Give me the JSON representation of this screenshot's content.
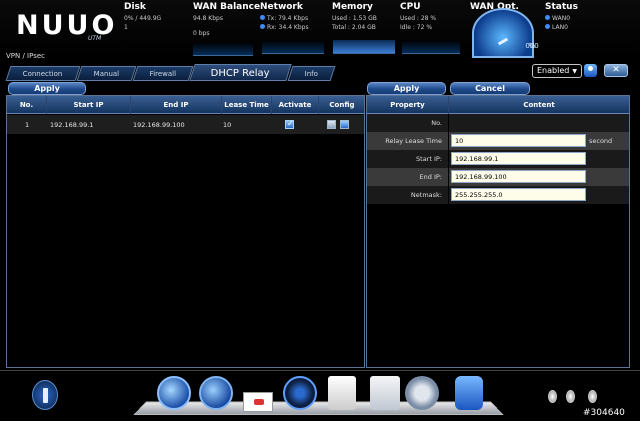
{
  "brand": {
    "logo": "NUUO",
    "logo_sub": "UTM"
  },
  "status": {
    "disk": {
      "title": "Disk",
      "value": "0% / 449.9G",
      "fill": 0.01,
      "line2": "1"
    },
    "wan_balance": {
      "title": "WAN Balance",
      "value": "94.8 Kbps",
      "value2": "0 bps"
    },
    "network": {
      "title": "Network",
      "tx": "Tx: 79.4 Kbps",
      "rx": "Rx: 34.4 Kbps"
    },
    "memory": {
      "title": "Memory",
      "used": "Used : 1.53 GB",
      "total": "Total : 2.04 GB"
    },
    "cpu": {
      "title": "CPU",
      "used": "Used : 28 %",
      "idle": "Idle : 72 %"
    },
    "wan_opt": {
      "title": "WAN Opt.",
      "gauge_value": "000",
      "gauge_unit": "%"
    },
    "status": {
      "title": "Status",
      "wan": "WAN0",
      "lan": "LAN0"
    }
  },
  "breadcrumb": "VPN / IPsec",
  "tabs": [
    {
      "label": "Connection",
      "active": false
    },
    {
      "label": "Manual",
      "active": false
    },
    {
      "label": "Firewall",
      "active": false
    },
    {
      "label": "DHCP Relay",
      "active": true
    },
    {
      "label": "Info",
      "active": false
    }
  ],
  "enabled_select": {
    "value": "Enabled"
  },
  "close_label": "✕",
  "left_panel": {
    "apply_label": "Apply",
    "columns": [
      "No.",
      "Start IP",
      "End IP",
      "Lease Time",
      "Activate",
      "Config"
    ],
    "rows": [
      {
        "no": "1",
        "start_ip": "192.168.99.1",
        "end_ip": "192.168.99.100",
        "lease_time": "10",
        "activate": true
      }
    ]
  },
  "right_panel": {
    "apply_label": "Apply",
    "cancel_label": "Cancel",
    "headers": {
      "property": "Property",
      "content": "Content"
    },
    "rows": [
      {
        "label": "No.",
        "value": ""
      },
      {
        "label": "Relay Lease Time",
        "value": "10",
        "suffix": "second"
      },
      {
        "label": "Start IP:",
        "value": "192.168.99.1"
      },
      {
        "label": "End IP:",
        "value": "192.168.99.100"
      },
      {
        "label": "Netmask:",
        "value": "255.255.255.0"
      }
    ]
  },
  "dock": {
    "icons": [
      "globe-icon",
      "shield-icon",
      "wifi-icon",
      "document-icon",
      "chart-icon",
      "gear-icon",
      "puzzle-icon"
    ]
  },
  "image_id": "#304640"
}
